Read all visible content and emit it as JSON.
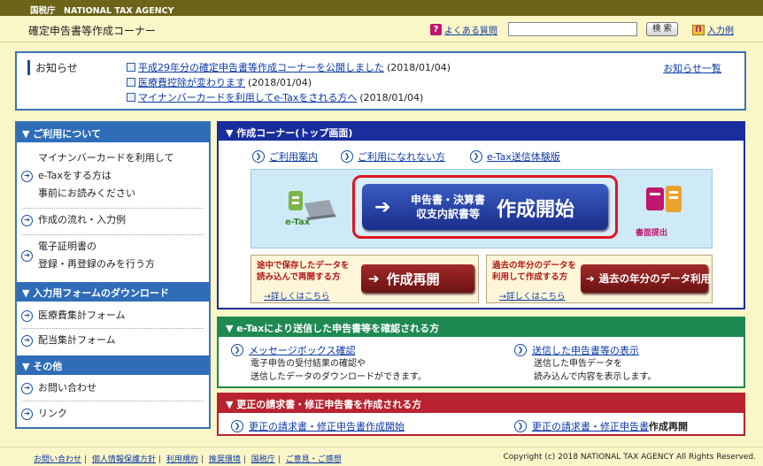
{
  "header": {
    "agency": "国税庁　NATIONAL TAX AGENCY",
    "site_title": "確定申告書等作成コーナー",
    "faq_label": "よくある質問",
    "search_button": "検 索",
    "input_example_label": "入力例"
  },
  "notice": {
    "title": "お知らせ",
    "list_link": "お知らせ一覧",
    "items": [
      {
        "link": "平成29年分の確定申告書等作成コーナーを公開しました",
        "date": "(2018/01/04)"
      },
      {
        "link": "医療費控除が変わります",
        "date": "(2018/01/04)"
      },
      {
        "link": "マイナンバーカードを利用してe-Taxをされる方へ",
        "date": "(2018/01/04)"
      }
    ]
  },
  "sidebar": {
    "about_head": "▼ ご利用について",
    "about_item1_line1": "マイナンバーカードを利用して",
    "about_item1_line2": "e-Taxをする方は",
    "about_item1_line3": "事前にお読みください",
    "about_item2": "作成の流れ・入力例",
    "about_item3_line1": "電子証明書の",
    "about_item3_line2": "登録・再登録のみを行う方",
    "download_head": "▼ 入力用フォームのダウンロード",
    "download_item1": "医療費集計フォーム",
    "download_item2": "配当集計フォーム",
    "other_head": "▼ その他",
    "other_item1": "お問い合わせ",
    "other_item2": "リンク"
  },
  "create": {
    "head": "▼ 作成コーナー(トップ画面)",
    "link1": "ご利用案内",
    "link2": "ご利用になれない方",
    "link3": "e-Tax送信体験版",
    "etax_label": "e-Tax",
    "start_sub_line1": "申告書・決算書",
    "start_sub_line2": "収支内訳書等",
    "start_main": "作成開始",
    "shomen_label": "書面提出",
    "resume_desc_line1": "途中で保存したデータを",
    "resume_desc_line2": "読み込んで再開する方",
    "resume_link": "→詳しくはこちら",
    "resume_btn": "作成再開",
    "past_desc_line1": "過去の年分のデータを",
    "past_desc_line2": "利用して作成する方",
    "past_link": "→詳しくはこちら",
    "past_btn": "過去の年分のデータ利用"
  },
  "confirm": {
    "head": "▼ e-Taxにより送信した申告書等を確認される方",
    "msgbox_link": "メッセージボックス確認",
    "msgbox_desc1": "電子申告の受付結果の確認や",
    "msgbox_desc2": "送信したデータのダウンロードができます。",
    "sent_link": "送信した申告書等の表示",
    "sent_desc1": "送信した申告データを",
    "sent_desc2": "読み込んで内容を表示します。"
  },
  "correct": {
    "head": "▼ 更正の請求書・修正申告書を作成される方",
    "link1": "更正の請求書・修正申告書作成開始",
    "link2_a": "更正の請求書・修正申告書",
    "link2_b": "作成再開"
  },
  "footer": {
    "links": [
      "お問い合わせ",
      "個人情報保護方針",
      "利用規約",
      "推奨環境",
      "国税庁",
      "ご意見・ご感想"
    ],
    "copyright": "Copyright (c) 2018 NATIONAL TAX AGENCY All Rights Reserved."
  }
}
